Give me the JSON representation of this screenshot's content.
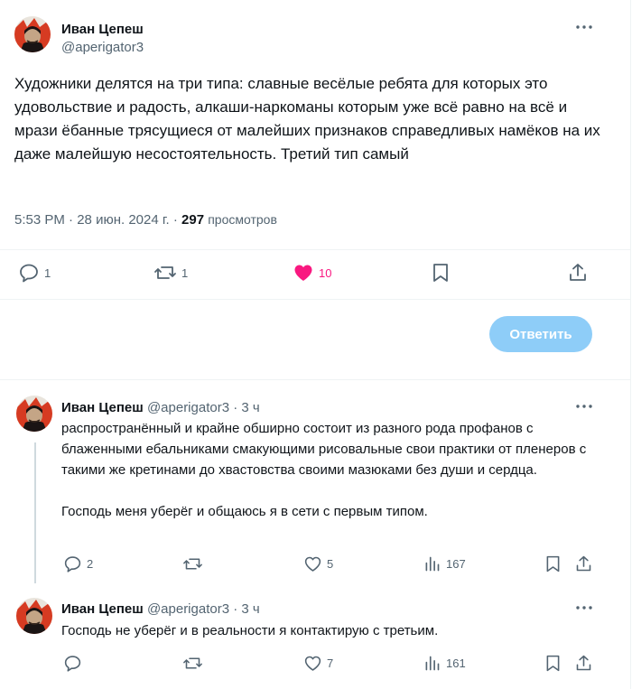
{
  "main_tweet": {
    "author_name": "Иван Цепеш",
    "author_handle": "@aperigator3",
    "text": "Художники делятся на три типа: славные весёлые ребята для которых это удовольствие и радость, алкаши-наркоманы которым уже всё равно на всё и мрази ёбанные трясущиеся от малейших признаков справедливых намёков на их даже малейшую несостоятельность. Третий тип самый",
    "time": "5:53 PM",
    "date": "28 июн. 2024 г.",
    "separator": "·",
    "views_count": "297",
    "views_label": "просмотров",
    "replies": "1",
    "retweets": "1",
    "likes": "10"
  },
  "reply_button_label": "Ответить",
  "replies": [
    {
      "author_name": "Иван Цепеш",
      "author_handle": "@aperigator3",
      "separator": "·",
      "time": "3 ч",
      "text": "распространённый и крайне обширно состоит из разного рода профанов с блаженными ебальниками смакующими рисовальные свои практики от пленеров с такими же кретинами до хвастовства своими мазюками без души и сердца.\n\nГосподь меня уберёг и общаюсь я в сети с первым типом.",
      "replies": "2",
      "retweets": "",
      "likes": "5",
      "views": "167"
    },
    {
      "author_name": "Иван Цепеш",
      "author_handle": "@aperigator3",
      "separator": "·",
      "time": "3 ч",
      "text": "Господь не уберёг и в реальности я контактирую с третьим.",
      "replies": "",
      "retweets": "",
      "likes": "7",
      "views": "161"
    }
  ],
  "icons": {
    "reply": "reply-icon",
    "retweet": "retweet-icon",
    "like": "heart-icon",
    "bookmark": "bookmark-icon",
    "share": "share-icon",
    "views": "views-icon",
    "more": "more-icon"
  },
  "colors": {
    "like_active": "#f91880",
    "reply_button": "#8ecdf8",
    "secondary_text": "#536471",
    "thread_line": "#cfd9de"
  }
}
